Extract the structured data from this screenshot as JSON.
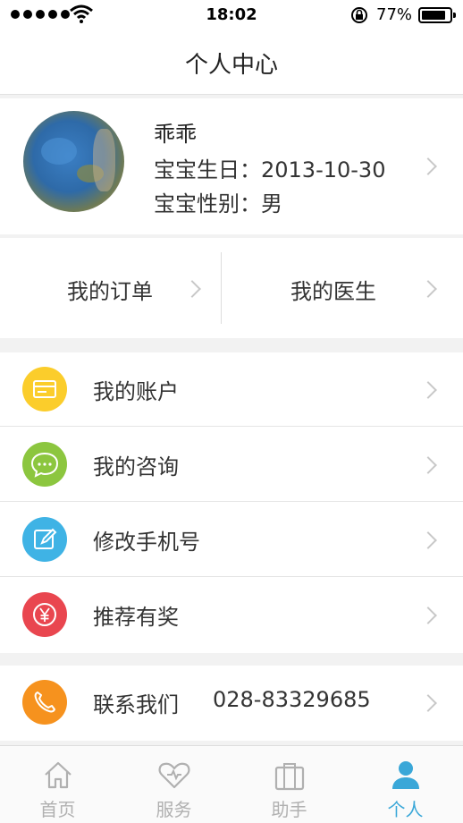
{
  "status_bar": {
    "time": "18:02",
    "battery_percent": "77%",
    "battery_level": 0.77
  },
  "nav": {
    "title": "个人中心"
  },
  "profile": {
    "name": "乖乖",
    "birthday_line": "宝宝生日：2013-10-30",
    "gender_line": "宝宝性别：男"
  },
  "quick_links": {
    "orders": "我的订单",
    "doctors": "我的医生"
  },
  "menu": {
    "items": [
      {
        "label": "我的账户",
        "icon": "card-icon",
        "color": "#fbcd2b"
      },
      {
        "label": "我的咨询",
        "icon": "chat-bubble-icon",
        "color": "#8cc63f"
      },
      {
        "label": "修改手机号",
        "icon": "edit-icon",
        "color": "#3fb3e5"
      },
      {
        "label": "推荐有奖",
        "icon": "yen-icon",
        "color": "#e9464f"
      }
    ],
    "contact": {
      "label": "联系我们",
      "phone": "028-83329685",
      "icon": "phone-icon",
      "color": "#f6921e"
    }
  },
  "tabs": [
    {
      "label": "首页",
      "icon": "home-icon"
    },
    {
      "label": "服务",
      "icon": "heart-icon"
    },
    {
      "label": "助手",
      "icon": "bag-icon"
    },
    {
      "label": "个人",
      "icon": "person-icon",
      "active": true
    }
  ],
  "colors": {
    "accent": "#3aa7d8",
    "inactive_tab": "#b0b0b0"
  }
}
